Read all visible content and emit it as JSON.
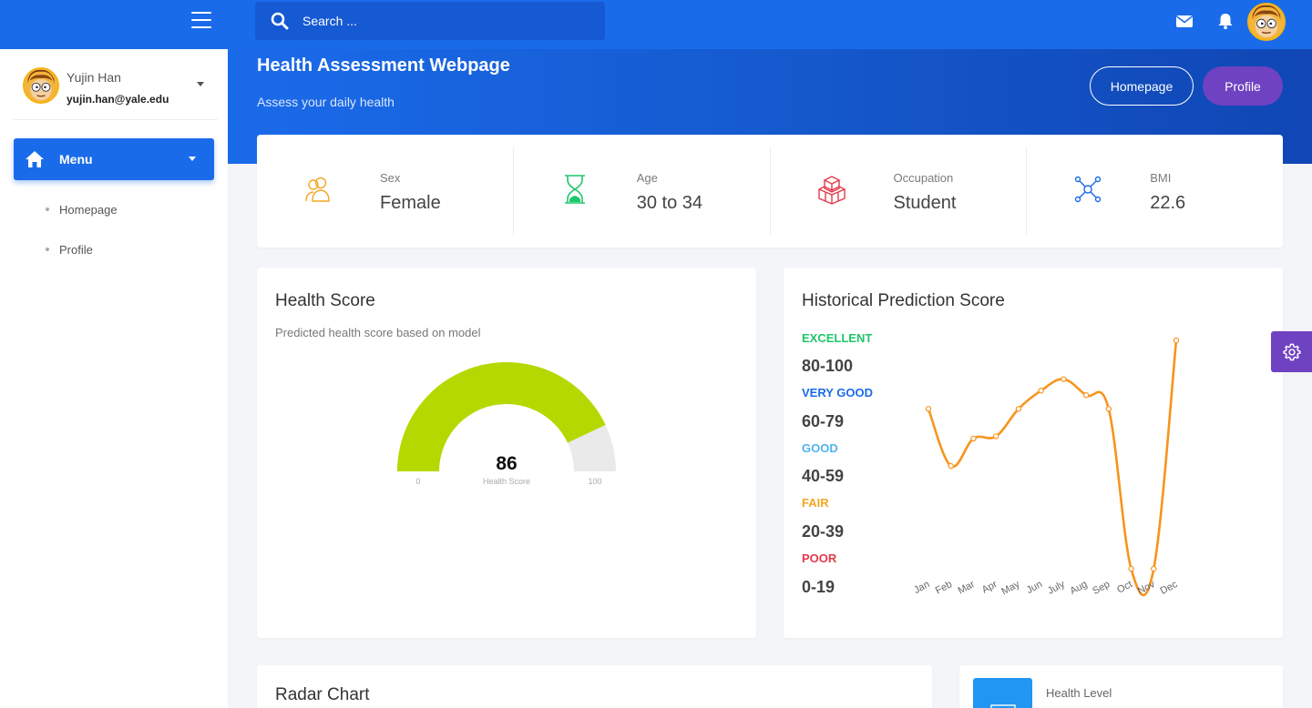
{
  "search": {
    "placeholder": "Search ..."
  },
  "user": {
    "name": "Yujin Han",
    "email": "yujin.han@yale.edu"
  },
  "sidebar": {
    "menu_label": "Menu",
    "items": [
      {
        "label": "Homepage"
      },
      {
        "label": "Profile"
      }
    ]
  },
  "header": {
    "title": "Health Assessment Webpage",
    "subtitle": "Assess your daily health",
    "homepage_button": "Homepage",
    "profile_button": "Profile"
  },
  "stats": [
    {
      "label": "Sex",
      "value": "Female",
      "icon": "users-icon",
      "color": "#f5a623"
    },
    {
      "label": "Age",
      "value": "30 to 34",
      "icon": "hourglass-icon",
      "color": "#21c56b"
    },
    {
      "label": "Occupation",
      "value": "Student",
      "icon": "boxes-icon",
      "color": "#e5394a"
    },
    {
      "label": "BMI",
      "value": "22.6",
      "icon": "network-icon",
      "color": "#1a6bea"
    }
  ],
  "health_score": {
    "title": "Health Score",
    "subtitle": "Predicted health score based on model",
    "value": 86,
    "min_label": "0",
    "max_label": "100",
    "value_caption": "Health Score",
    "gauge_color": "#b5d900",
    "track_color": "#eaeaea"
  },
  "history": {
    "title": "Historical Prediction Score",
    "levels": [
      {
        "name": "EXCELLENT",
        "range": "80-100",
        "color": "#21c56b"
      },
      {
        "name": "VERY GOOD",
        "range": "60-79",
        "color": "#1a6bea"
      },
      {
        "name": "GOOD",
        "range": "40-59",
        "color": "#4fb4ee"
      },
      {
        "name": "FAIR",
        "range": "20-39",
        "color": "#f5a623"
      },
      {
        "name": "POOR",
        "range": "0-19",
        "color": "#e5394a"
      }
    ]
  },
  "chart_data": {
    "type": "line",
    "categories": [
      "Jan",
      "Feb",
      "Mar",
      "Apr",
      "May",
      "Jun",
      "July",
      "Aug",
      "Sep",
      "Oct",
      "Nov",
      "Dec"
    ],
    "series": [
      {
        "values": [
          70,
          45,
          57,
          58,
          70,
          78,
          83,
          76,
          70,
          0,
          0,
          100
        ],
        "color": "#f7941d"
      }
    ],
    "ylim": [
      0,
      100
    ],
    "title": "",
    "xlabel": "",
    "ylabel": ""
  },
  "radar": {
    "title": "Radar Chart"
  },
  "health_level": {
    "label": "Health Level"
  },
  "colors": {
    "primary": "#1a6bea",
    "accent": "#6f42c1"
  }
}
